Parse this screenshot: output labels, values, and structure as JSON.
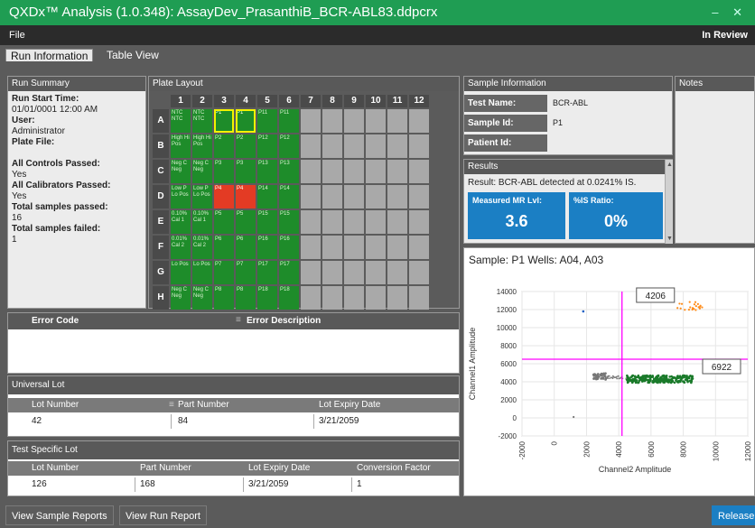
{
  "window": {
    "title": "QXDx™ Analysis (1.0.348): AssayDev_PrasanthiB_BCR-ABL83.ddpcrx",
    "controls": "–  ✕"
  },
  "menu": {
    "file": "File",
    "status": "In Review"
  },
  "tabs": {
    "run_information": "Run Information",
    "table_view": "Table View"
  },
  "run_summary": {
    "header": "Run Summary",
    "start_time_label": "Run Start Time:",
    "start_time_value": "01/01/0001 12:00 AM",
    "user_label": "User:",
    "user_value": "Administrator",
    "plate_file_label": "Plate File:",
    "controls_label": "All Controls Passed:",
    "controls_value": "Yes",
    "calibrators_label": "All Calibrators Passed:",
    "calibrators_value": "Yes",
    "passed_label": "Total samples passed:",
    "passed_value": "16",
    "failed_label": "Total samples failed:",
    "failed_value": "1"
  },
  "plate_layout": {
    "header": "Plate Layout",
    "columns": [
      "1",
      "2",
      "3",
      "4",
      "5",
      "6",
      "7",
      "8",
      "9",
      "10",
      "11",
      "12"
    ],
    "rows": [
      "A",
      "B",
      "C",
      "D",
      "E",
      "F",
      "G",
      "H"
    ],
    "wells": [
      [
        [
          "NTC NTC",
          "g"
        ],
        [
          "NTC NTC",
          "g"
        ],
        [
          "P1",
          "gs"
        ],
        [
          "P1",
          "gs"
        ],
        [
          "P11",
          "g"
        ],
        [
          "P11",
          "g"
        ]
      ],
      [
        [
          "High Hi Pos",
          "g"
        ],
        [
          "High Hi Pos",
          "g"
        ],
        [
          "P2",
          "g"
        ],
        [
          "P2",
          "g"
        ],
        [
          "P12",
          "g"
        ],
        [
          "P12",
          "g"
        ]
      ],
      [
        [
          "Neg C Neg",
          "g"
        ],
        [
          "Neg C Neg",
          "g"
        ],
        [
          "P3",
          "g"
        ],
        [
          "P3",
          "g"
        ],
        [
          "P13",
          "g"
        ],
        [
          "P13",
          "g"
        ]
      ],
      [
        [
          "Low P Lo Pos",
          "g"
        ],
        [
          "Low P Lo Pos",
          "g"
        ],
        [
          "P4",
          "r"
        ],
        [
          "P4",
          "r"
        ],
        [
          "P14",
          "g"
        ],
        [
          "P14",
          "g"
        ]
      ],
      [
        [
          "0.10% Cal 1",
          "g"
        ],
        [
          "0.10% Cal 1",
          "g"
        ],
        [
          "P5",
          "g"
        ],
        [
          "P5",
          "g"
        ],
        [
          "P15",
          "g"
        ],
        [
          "P15",
          "g"
        ]
      ],
      [
        [
          "0.01% Cal 2",
          "g"
        ],
        [
          "0.01% Cal 2",
          "g"
        ],
        [
          "P6",
          "g"
        ],
        [
          "P6",
          "g"
        ],
        [
          "P16",
          "g"
        ],
        [
          "P16",
          "g"
        ]
      ],
      [
        [
          "Lo Pos",
          "g"
        ],
        [
          "Lo Pos",
          "g"
        ],
        [
          "P7",
          "g"
        ],
        [
          "P7",
          "g"
        ],
        [
          "P17",
          "g"
        ],
        [
          "P17",
          "g"
        ]
      ],
      [
        [
          "Neg C Neg",
          "g"
        ],
        [
          "Neg C Neg",
          "g"
        ],
        [
          "P8",
          "g"
        ],
        [
          "P8",
          "g"
        ],
        [
          "P18",
          "g"
        ],
        [
          "P18",
          "g"
        ]
      ]
    ]
  },
  "sample_info": {
    "header": "Sample Information",
    "test_name_label": "Test Name:",
    "test_name_value": "BCR-ABL",
    "sample_id_label": "Sample Id:",
    "sample_id_value": "P1",
    "patient_id_label": "Patient Id:",
    "patient_id_value": ""
  },
  "notes": {
    "header": "Notes"
  },
  "results": {
    "header": "Results",
    "result_line": "Result: BCR-ABL detected at 0.0241% IS.",
    "mr_label": "Measured MR Lvl:",
    "mr_value": "3.6",
    "is_label": "%IS Ratio:",
    "is_value": "0%"
  },
  "sample_plot": {
    "title": "Sample: P1 Wells: A04, A03",
    "xlabel": "Channel2 Amplitude",
    "ylabel": "Channel1 Amplitude",
    "xticks": [
      "-2000",
      "0",
      "2000",
      "4000",
      "6000",
      "8000",
      "10000",
      "12000"
    ],
    "yticks": [
      "14000",
      "12000",
      "10000",
      "8000",
      "6000",
      "4000",
      "2000",
      "0",
      "-2000"
    ],
    "count_top": "4206",
    "count_right": "6922",
    "colors": {
      "threshold": "#ff00ff",
      "pos": "#ff8c1a",
      "neg": "#1a7a2a",
      "dneg": "#777777",
      "ch1": "#1b5fc4"
    }
  },
  "errors": {
    "col_code": "Error Code",
    "col_desc": "Error Description"
  },
  "universal_lot": {
    "header": "Universal Lot",
    "columns": [
      "Lot Number",
      "Part Number",
      "Lot Expiry Date"
    ],
    "row": [
      "42",
      "84",
      "3/21/2059"
    ]
  },
  "test_lot": {
    "header": "Test Specific Lot",
    "columns": [
      "Lot Number",
      "Part Number",
      "Lot Expiry Date",
      "Conversion Factor"
    ],
    "row": [
      "126",
      "168",
      "3/21/2059",
      "1"
    ]
  },
  "buttons": {
    "sample_reports": "View Sample Reports",
    "run_report": "View Run Report",
    "release": "Release"
  }
}
